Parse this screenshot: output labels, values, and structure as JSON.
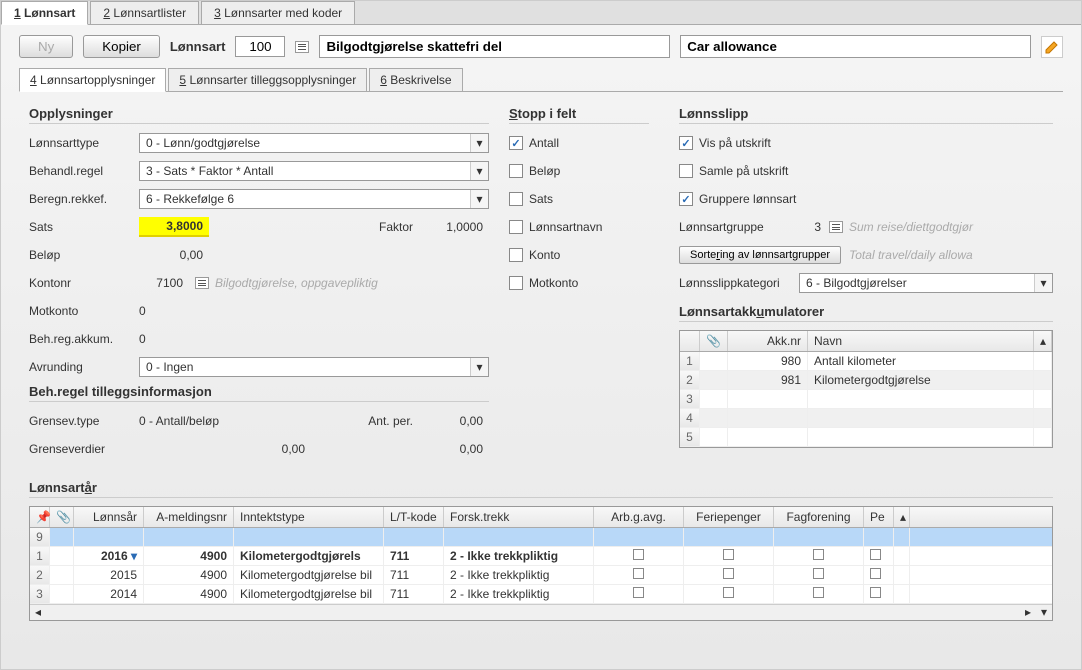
{
  "topTabs": [
    "1 Lønnsart",
    "2 Lønnsartlister",
    "3 Lønnsarter med koder"
  ],
  "toolbar": {
    "ny": "Ny",
    "kopier": "Kopier",
    "lonnsart": "Lønnsart",
    "code": "100",
    "name_no": "Bilgodtgjørelse skattefri del",
    "name_en": "Car allowance"
  },
  "subTabs": [
    "4 Lønnsartopplysninger",
    "5 Lønnsarter tilleggsopplysninger",
    "6 Beskrivelse"
  ],
  "opplysninger": {
    "title": "Opplysninger",
    "rows": {
      "lonnsarttype": {
        "label": "Lønnsarttype",
        "value": "0 - Lønn/godtgjørelse"
      },
      "behandlregel": {
        "label": "Behandl.regel",
        "value": "3 - Sats * Faktor * Antall"
      },
      "beregnrekkef": {
        "label": "Beregn.rekkef.",
        "value": "6 - Rekkefølge 6"
      },
      "sats": {
        "label": "Sats",
        "value": "3,8000",
        "faktor_label": "Faktor",
        "faktor_value": "1,0000"
      },
      "belop": {
        "label": "Beløp",
        "value": "0,00"
      },
      "kontonr": {
        "label": "Kontonr",
        "value": "7100",
        "hint": "Bilgodtgjørelse, oppgavepliktig"
      },
      "motkonto": {
        "label": "Motkonto",
        "value": "0"
      },
      "behregakkum": {
        "label": "Beh.reg.akkum.",
        "value": "0"
      },
      "avrunding": {
        "label": "Avrunding",
        "value": "0 - Ingen"
      }
    }
  },
  "tillegg": {
    "title": "Beh.regel tilleggsinformasjon",
    "grensevtype": {
      "label": "Grensev.type",
      "value": "0 - Antall/beløp",
      "antper_label": "Ant. per.",
      "antper_val": "0,00"
    },
    "grenseverdier": {
      "label": "Grenseverdier",
      "val1": "0,00",
      "val2": "0,00"
    }
  },
  "stopp": {
    "title": "Stopp i felt",
    "items": [
      {
        "label": "Antall",
        "checked": true
      },
      {
        "label": "Beløp",
        "checked": false
      },
      {
        "label": "Sats",
        "checked": false
      },
      {
        "label": "Lønnsartnavn",
        "checked": false
      },
      {
        "label": "Konto",
        "checked": false
      },
      {
        "label": "Motkonto",
        "checked": false
      }
    ]
  },
  "lonnsslipp": {
    "title": "Lønnsslipp",
    "vis": {
      "label": "Vis på utskrift",
      "checked": true
    },
    "samle": {
      "label": "Samle på utskrift",
      "checked": false
    },
    "gruppere": {
      "label": "Gruppere lønnsart",
      "checked": true
    },
    "gruppe": {
      "label": "Lønnsartgruppe",
      "value": "3",
      "hint": "Sum reise/diettgodtgjør"
    },
    "sortering": "Sortering av lønnsartgrupper",
    "sortering_hint": "Total travel/daily allowa",
    "kategori": {
      "label": "Lønnsslippkategori",
      "value": "6 - Bilgodtgjørelser"
    }
  },
  "akkum": {
    "title": "Lønnsartakkumulatorer",
    "headers": {
      "attach": "📎",
      "akknr": "Akk.nr",
      "navn": "Navn"
    },
    "rows": [
      {
        "n": "1",
        "akknr": "980",
        "navn": "Antall kilometer"
      },
      {
        "n": "2",
        "akknr": "981",
        "navn": "Kilometergodtgjørelse"
      },
      {
        "n": "3"
      },
      {
        "n": "4"
      },
      {
        "n": "5"
      }
    ]
  },
  "lonnsartaar": {
    "title": "Lønnsartår",
    "headers": [
      "Lønnsår",
      "A-meldingsnr",
      "Inntektstype",
      "L/T-kode",
      "Forsk.trekk",
      "Arb.g.avg.",
      "Feriepenger",
      "Fagforening",
      "Pe"
    ],
    "rows": [
      {
        "n": "9",
        "selected": true
      },
      {
        "n": "1",
        "year": "2016",
        "amelding": "4900",
        "type": "Kilometergodtgjørels",
        "lt": "711",
        "forsk": "2 - Ikke trekkpliktig",
        "bold": true,
        "drop": true
      },
      {
        "n": "2",
        "year": "2015",
        "amelding": "4900",
        "type": "Kilometergodtgjørelse bil",
        "lt": "711",
        "forsk": "2 - Ikke trekkpliktig"
      },
      {
        "n": "3",
        "year": "2014",
        "amelding": "4900",
        "type": "Kilometergodtgjørelse bil",
        "lt": "711",
        "forsk": "2 - Ikke trekkpliktig"
      }
    ]
  }
}
